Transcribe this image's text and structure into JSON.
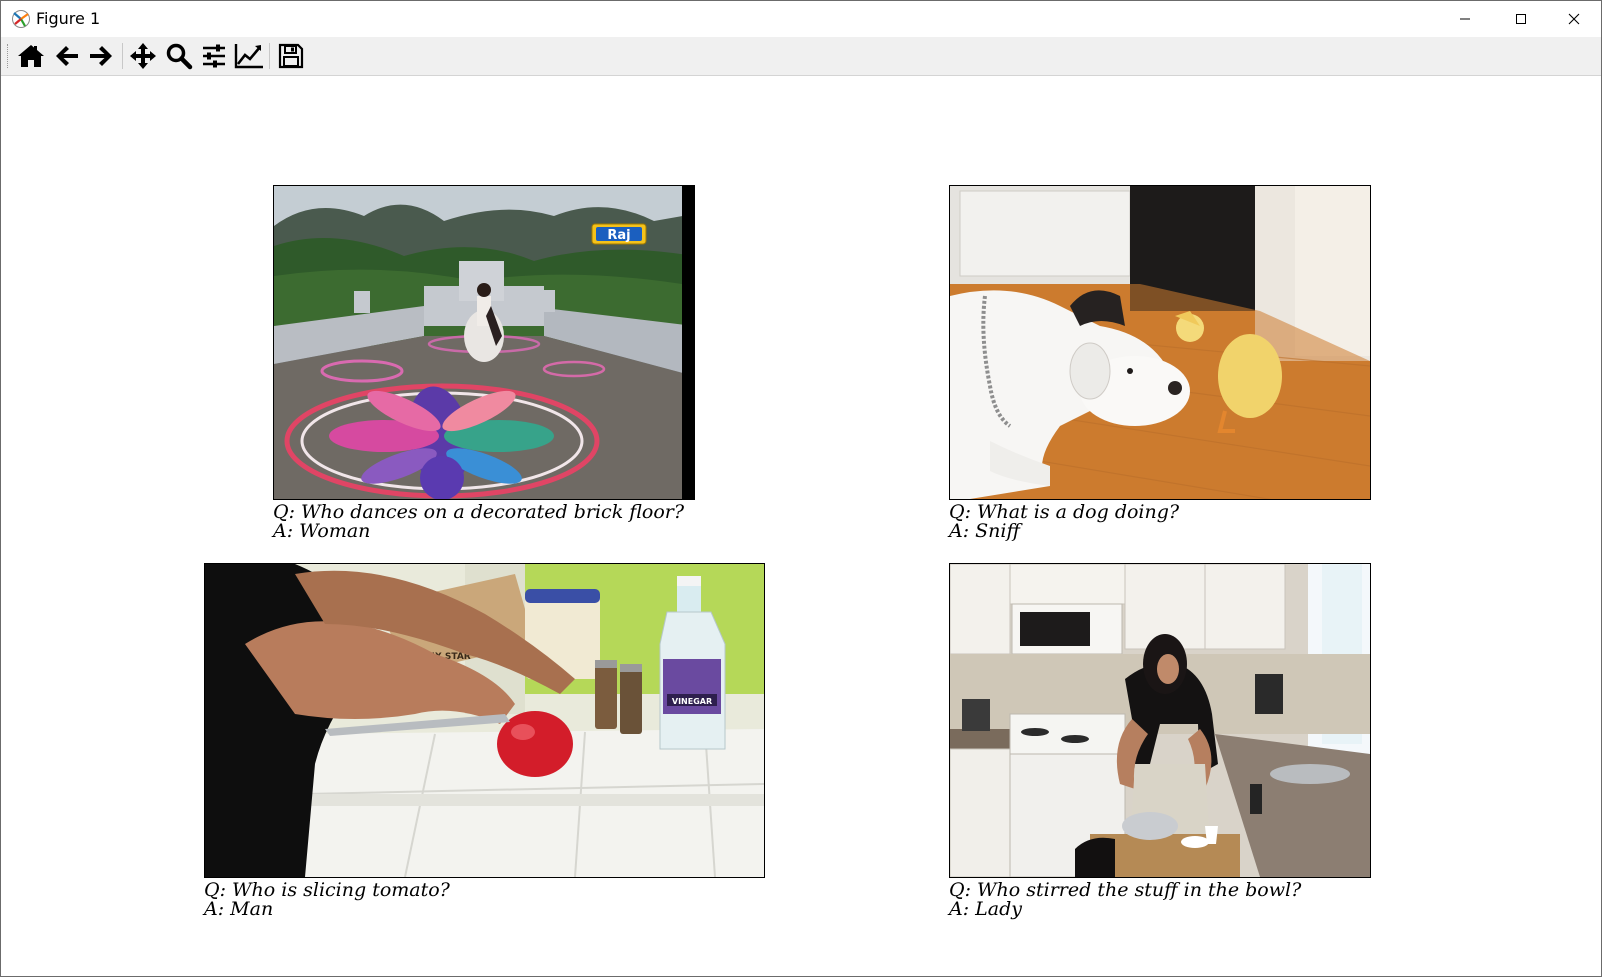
{
  "window": {
    "title": "Figure 1"
  },
  "toolbar": {
    "buttons": [
      {
        "id": "home",
        "icon": "home-icon"
      },
      {
        "id": "back",
        "icon": "arrow-left-icon"
      },
      {
        "id": "forward",
        "icon": "arrow-right-icon"
      },
      {
        "id": "pan",
        "icon": "move-icon"
      },
      {
        "id": "zoom",
        "icon": "magnifier-icon"
      },
      {
        "id": "subplots",
        "icon": "sliders-icon"
      },
      {
        "id": "axes",
        "icon": "line-chart-icon"
      },
      {
        "id": "save",
        "icon": "floppy-disk-icon"
      }
    ]
  },
  "figures": [
    {
      "question": "Q: Who dances on a decorated brick floor?",
      "answer": "A: Woman",
      "logo_text": "Raj"
    },
    {
      "question": "Q: What is a dog doing?",
      "answer": "A: Sniff"
    },
    {
      "question": "Q: Who is slicing tomato?",
      "answer": "A: Man",
      "label_texts": [
        "SIX STAR",
        "VINEGAR"
      ]
    },
    {
      "question": "Q: Who stirred the stuff in the bowl?",
      "answer": "A: Lady"
    }
  ]
}
